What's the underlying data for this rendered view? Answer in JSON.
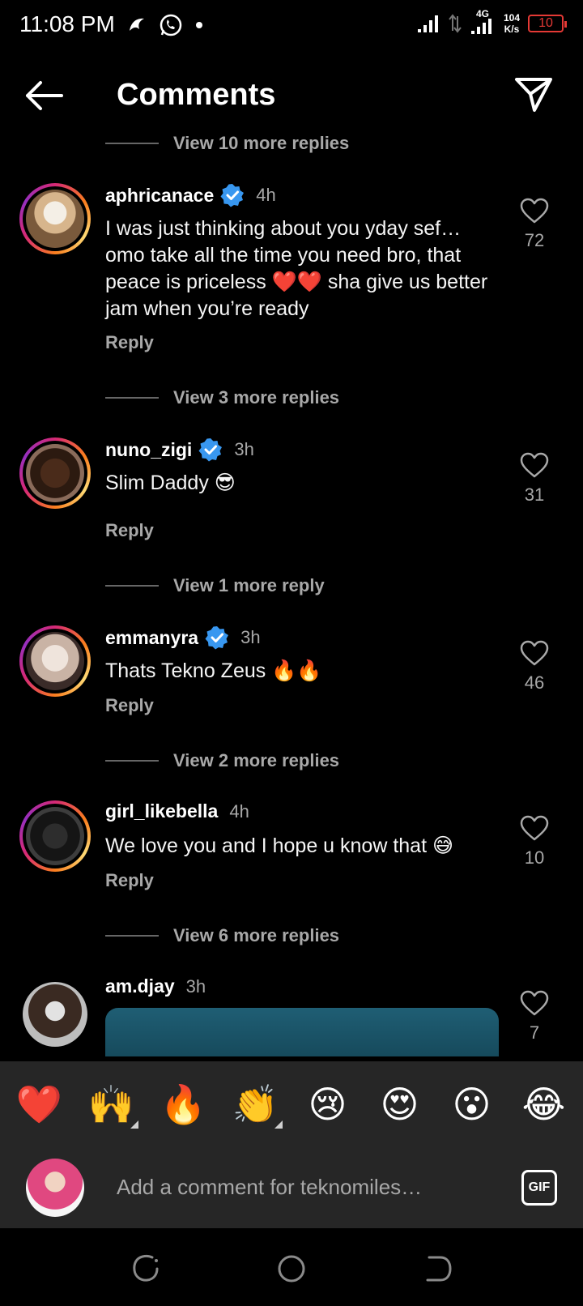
{
  "status_bar": {
    "time": "11:08 PM",
    "network": "4G",
    "speed_value": "104",
    "speed_unit": "K/s",
    "battery": "10"
  },
  "header": {
    "title": "Comments"
  },
  "view_more_top": "View 10 more replies",
  "comments": [
    {
      "username": "aphricanace",
      "verified": true,
      "time": "4h",
      "text": "I was just thinking about you yday sef… omo take all the time you need bro, that peace is priceless ❤️❤️ sha give us better jam when you’re ready",
      "reply_label": "Reply",
      "likes": "72",
      "view_more": "View 3 more replies"
    },
    {
      "username": "nuno_zigi",
      "verified": true,
      "time": "3h",
      "text": "Slim Daddy 😎",
      "reply_label": "Reply",
      "likes": "31",
      "view_more": "View 1 more reply"
    },
    {
      "username": "emmanyra",
      "verified": true,
      "time": "3h",
      "text": "Thats Tekno Zeus 🔥🔥",
      "reply_label": "Reply",
      "likes": "46",
      "view_more": "View 2 more replies"
    },
    {
      "username": "girl_likebella",
      "verified": false,
      "time": "4h",
      "text": "We love you and I hope u know that 😅",
      "reply_label": "Reply",
      "likes": "10",
      "view_more": "View 6 more replies"
    },
    {
      "username": "am.djay",
      "verified": false,
      "time": "3h",
      "likes": "7"
    }
  ],
  "emoji_bar": [
    "❤️",
    "🙌",
    "🔥",
    "👏",
    "😢",
    "😍",
    "😮",
    "😂"
  ],
  "composer": {
    "placeholder": "Add a comment for teknomiles…",
    "gif_label": "GIF"
  },
  "colors": {
    "background": "#000000",
    "secondary_text": "#a8a8a8",
    "verified_blue": "#3897f0",
    "battery_low": "#e53935",
    "panel": "#262626"
  }
}
